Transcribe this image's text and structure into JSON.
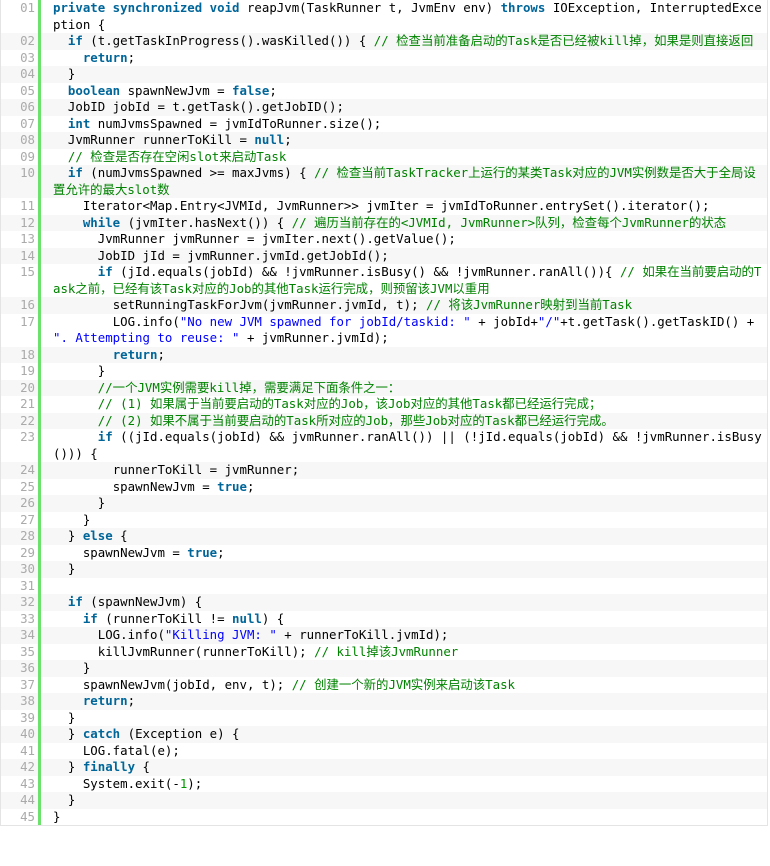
{
  "colors": {
    "keyword": "#006699",
    "comment": "#008200",
    "string": "#0000ff",
    "number": "#009900",
    "gutter_border": "#6ce26c",
    "line_number": "#aaaaaa"
  },
  "lines": [
    {
      "n": "01",
      "tokens": [
        [
          "kw",
          "private synchronized void"
        ],
        [
          "pl",
          " reapJvm(TaskRunner t, JvmEnv env) "
        ],
        [
          "kw",
          "throws"
        ],
        [
          "pl",
          " IOException, InterruptedException {"
        ]
      ]
    },
    {
      "n": "02",
      "tokens": [
        [
          "pl",
          "  "
        ],
        [
          "kw",
          "if"
        ],
        [
          "pl",
          " (t.getTaskInProgress().wasKilled()) { "
        ],
        [
          "cm",
          "// 检查当前准备启动的Task是否已经被kill掉，如果是则直接返回"
        ]
      ]
    },
    {
      "n": "03",
      "tokens": [
        [
          "pl",
          "    "
        ],
        [
          "kw",
          "return"
        ],
        [
          "pl",
          ";"
        ]
      ]
    },
    {
      "n": "04",
      "tokens": [
        [
          "pl",
          "  }"
        ]
      ]
    },
    {
      "n": "05",
      "tokens": [
        [
          "pl",
          "  "
        ],
        [
          "kw",
          "boolean"
        ],
        [
          "pl",
          " spawnNewJvm = "
        ],
        [
          "kw",
          "false"
        ],
        [
          "pl",
          ";"
        ]
      ]
    },
    {
      "n": "06",
      "tokens": [
        [
          "pl",
          "  JobID jobId = t.getTask().getJobID();"
        ]
      ]
    },
    {
      "n": "07",
      "tokens": [
        [
          "pl",
          "  "
        ],
        [
          "kw",
          "int"
        ],
        [
          "pl",
          " numJvmsSpawned = jvmIdToRunner.size();"
        ]
      ]
    },
    {
      "n": "08",
      "tokens": [
        [
          "pl",
          "  JvmRunner runnerToKill = "
        ],
        [
          "kw",
          "null"
        ],
        [
          "pl",
          ";"
        ]
      ]
    },
    {
      "n": "09",
      "tokens": [
        [
          "pl",
          "  "
        ],
        [
          "cm",
          "// 检查是否存在空闲slot来启动Task"
        ]
      ]
    },
    {
      "n": "10",
      "tokens": [
        [
          "pl",
          "  "
        ],
        [
          "kw",
          "if"
        ],
        [
          "pl",
          " (numJvmsSpawned >= maxJvms) { "
        ],
        [
          "cm",
          "// 检查当前TaskTracker上运行的某类Task对应的JVM实例数是否大于全局设置允许的最大slot数"
        ]
      ]
    },
    {
      "n": "11",
      "tokens": [
        [
          "pl",
          "    Iterator<Map.Entry<JVMId, JvmRunner>> jvmIter = jvmIdToRunner.entrySet().iterator();"
        ]
      ]
    },
    {
      "n": "12",
      "tokens": [
        [
          "pl",
          "    "
        ],
        [
          "kw",
          "while"
        ],
        [
          "pl",
          " (jvmIter.hasNext()) { "
        ],
        [
          "cm",
          "// 遍历当前存在的<JVMId, JvmRunner>队列，检查每个JvmRunner的状态"
        ]
      ]
    },
    {
      "n": "13",
      "tokens": [
        [
          "pl",
          "      JvmRunner jvmRunner = jvmIter.next().getValue();"
        ]
      ]
    },
    {
      "n": "14",
      "tokens": [
        [
          "pl",
          "      JobID jId = jvmRunner.jvmId.getJobId();"
        ]
      ]
    },
    {
      "n": "15",
      "tokens": [
        [
          "pl",
          "      "
        ],
        [
          "kw",
          "if"
        ],
        [
          "pl",
          " (jId.equals(jobId) && !jvmRunner.isBusy() && !jvmRunner.ranAll()){ "
        ],
        [
          "cm",
          "// 如果在当前要启动的Task之前，已经有该Task对应的Job的其他Task运行完成，则预留该JVM以重用"
        ]
      ]
    },
    {
      "n": "16",
      "tokens": [
        [
          "pl",
          "        setRunningTaskForJvm(jvmRunner.jvmId, t); "
        ],
        [
          "cm",
          "// 将该JvmRunner映射到当前Task"
        ]
      ]
    },
    {
      "n": "17",
      "tokens": [
        [
          "pl",
          "        LOG.info("
        ],
        [
          "st",
          "\"No new JVM spawned for jobId/taskid: \""
        ],
        [
          "pl",
          " + jobId+"
        ],
        [
          "st",
          "\"/\""
        ],
        [
          "pl",
          "+t.getTask().getTaskID() + "
        ],
        [
          "st",
          "\". Attempting to reuse: \""
        ],
        [
          "pl",
          " + jvmRunner.jvmId);"
        ]
      ]
    },
    {
      "n": "18",
      "tokens": [
        [
          "pl",
          "        "
        ],
        [
          "kw",
          "return"
        ],
        [
          "pl",
          ";"
        ]
      ]
    },
    {
      "n": "19",
      "tokens": [
        [
          "pl",
          "      }"
        ]
      ]
    },
    {
      "n": "20",
      "tokens": [
        [
          "pl",
          "      "
        ],
        [
          "cm",
          "//一个JVM实例需要kill掉，需要满足下面条件之一："
        ]
      ]
    },
    {
      "n": "21",
      "tokens": [
        [
          "pl",
          "      "
        ],
        [
          "cm",
          "// (1) 如果属于当前要启动的Task对应的Job，该Job对应的其他Task都已经运行完成；"
        ]
      ]
    },
    {
      "n": "22",
      "tokens": [
        [
          "pl",
          "      "
        ],
        [
          "cm",
          "// (2) 如果不属于当前要启动的Task所对应的Job，那些Job对应的Task都已经运行完成。"
        ]
      ]
    },
    {
      "n": "23",
      "tokens": [
        [
          "pl",
          "      "
        ],
        [
          "kw",
          "if"
        ],
        [
          "pl",
          " ((jId.equals(jobId) && jvmRunner.ranAll()) || (!jId.equals(jobId) && !jvmRunner.isBusy())) {"
        ]
      ]
    },
    {
      "n": "24",
      "tokens": [
        [
          "pl",
          "        runnerToKill = jvmRunner;"
        ]
      ]
    },
    {
      "n": "25",
      "tokens": [
        [
          "pl",
          "        spawnNewJvm = "
        ],
        [
          "kw",
          "true"
        ],
        [
          "pl",
          ";"
        ]
      ]
    },
    {
      "n": "26",
      "tokens": [
        [
          "pl",
          "      }"
        ]
      ]
    },
    {
      "n": "27",
      "tokens": [
        [
          "pl",
          "    }"
        ]
      ]
    },
    {
      "n": "28",
      "tokens": [
        [
          "pl",
          "  } "
        ],
        [
          "kw",
          "else"
        ],
        [
          "pl",
          " {"
        ]
      ]
    },
    {
      "n": "29",
      "tokens": [
        [
          "pl",
          "    spawnNewJvm = "
        ],
        [
          "kw",
          "true"
        ],
        [
          "pl",
          ";"
        ]
      ]
    },
    {
      "n": "30",
      "tokens": [
        [
          "pl",
          "  }"
        ]
      ]
    },
    {
      "n": "31",
      "tokens": [
        [
          "pl",
          " "
        ]
      ]
    },
    {
      "n": "32",
      "tokens": [
        [
          "pl",
          "  "
        ],
        [
          "kw",
          "if"
        ],
        [
          "pl",
          " (spawnNewJvm) {"
        ]
      ]
    },
    {
      "n": "33",
      "tokens": [
        [
          "pl",
          "    "
        ],
        [
          "kw",
          "if"
        ],
        [
          "pl",
          " (runnerToKill != "
        ],
        [
          "kw",
          "null"
        ],
        [
          "pl",
          ") {"
        ]
      ]
    },
    {
      "n": "34",
      "tokens": [
        [
          "pl",
          "      LOG.info("
        ],
        [
          "st",
          "\"Killing JVM: \""
        ],
        [
          "pl",
          " + runnerToKill.jvmId);"
        ]
      ]
    },
    {
      "n": "35",
      "tokens": [
        [
          "pl",
          "      killJvmRunner(runnerToKill); "
        ],
        [
          "cm",
          "// kill掉该JvmRunner"
        ]
      ]
    },
    {
      "n": "36",
      "tokens": [
        [
          "pl",
          "    }"
        ]
      ]
    },
    {
      "n": "37",
      "tokens": [
        [
          "pl",
          "    spawnNewJvm(jobId, env, t); "
        ],
        [
          "cm",
          "// 创建一个新的JVM实例来启动该Task"
        ]
      ]
    },
    {
      "n": "38",
      "tokens": [
        [
          "pl",
          "    "
        ],
        [
          "kw",
          "return"
        ],
        [
          "pl",
          ";"
        ]
      ]
    },
    {
      "n": "39",
      "tokens": [
        [
          "pl",
          "  }"
        ]
      ]
    },
    {
      "n": "40",
      "tokens": [
        [
          "pl",
          "  } "
        ],
        [
          "kw",
          "catch"
        ],
        [
          "pl",
          " (Exception e) {"
        ]
      ]
    },
    {
      "n": "41",
      "tokens": [
        [
          "pl",
          "    LOG.fatal(e);"
        ]
      ]
    },
    {
      "n": "42",
      "tokens": [
        [
          "pl",
          "  } "
        ],
        [
          "kw",
          "finally"
        ],
        [
          "pl",
          " {"
        ]
      ]
    },
    {
      "n": "43",
      "tokens": [
        [
          "pl",
          "    System.exit(-"
        ],
        [
          "nm",
          "1"
        ],
        [
          "pl",
          ");"
        ]
      ]
    },
    {
      "n": "44",
      "tokens": [
        [
          "pl",
          "  }"
        ]
      ]
    },
    {
      "n": "45",
      "tokens": [
        [
          "pl",
          "}"
        ]
      ]
    }
  ]
}
